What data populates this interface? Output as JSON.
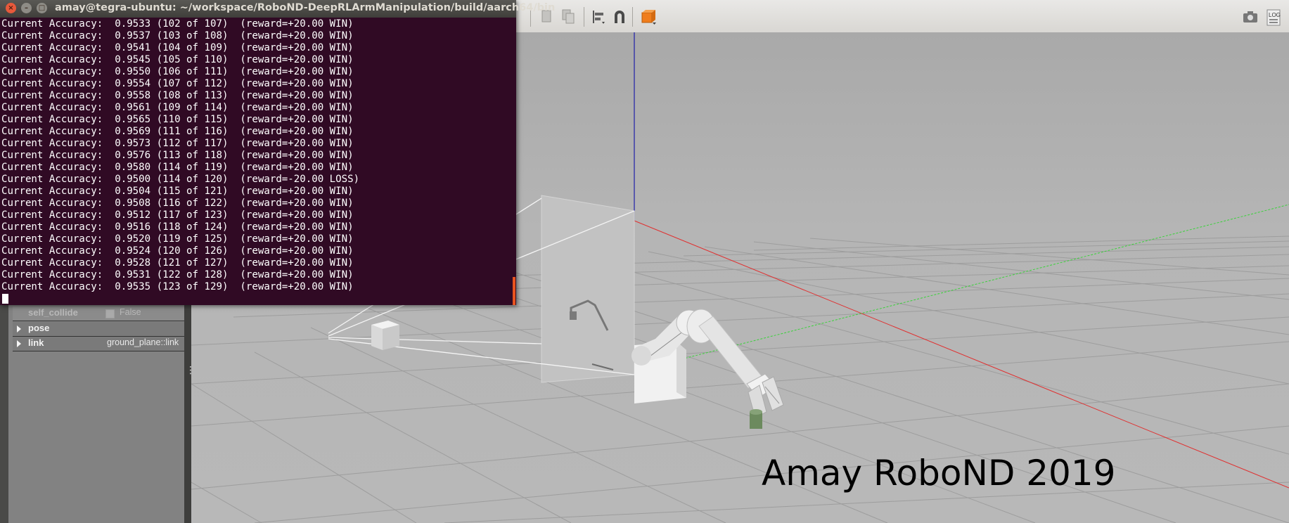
{
  "terminal": {
    "title": "amay@tegra-ubuntu: ~/workspace/RoboND-DeepRLArmManipulation/build/aarch64/bin",
    "lines": [
      "Current Accuracy:  0.9533 (102 of 107)  (reward=+20.00 WIN)",
      "Current Accuracy:  0.9537 (103 of 108)  (reward=+20.00 WIN)",
      "Current Accuracy:  0.9541 (104 of 109)  (reward=+20.00 WIN)",
      "Current Accuracy:  0.9545 (105 of 110)  (reward=+20.00 WIN)",
      "Current Accuracy:  0.9550 (106 of 111)  (reward=+20.00 WIN)",
      "Current Accuracy:  0.9554 (107 of 112)  (reward=+20.00 WIN)",
      "Current Accuracy:  0.9558 (108 of 113)  (reward=+20.00 WIN)",
      "Current Accuracy:  0.9561 (109 of 114)  (reward=+20.00 WIN)",
      "Current Accuracy:  0.9565 (110 of 115)  (reward=+20.00 WIN)",
      "Current Accuracy:  0.9569 (111 of 116)  (reward=+20.00 WIN)",
      "Current Accuracy:  0.9573 (112 of 117)  (reward=+20.00 WIN)",
      "Current Accuracy:  0.9576 (113 of 118)  (reward=+20.00 WIN)",
      "Current Accuracy:  0.9580 (114 of 119)  (reward=+20.00 WIN)",
      "Current Accuracy:  0.9500 (114 of 120)  (reward=-20.00 LOSS)",
      "Current Accuracy:  0.9504 (115 of 121)  (reward=+20.00 WIN)",
      "Current Accuracy:  0.9508 (116 of 122)  (reward=+20.00 WIN)",
      "Current Accuracy:  0.9512 (117 of 123)  (reward=+20.00 WIN)",
      "Current Accuracy:  0.9516 (118 of 124)  (reward=+20.00 WIN)",
      "Current Accuracy:  0.9520 (119 of 125)  (reward=+20.00 WIN)",
      "Current Accuracy:  0.9524 (120 of 126)  (reward=+20.00 WIN)",
      "Current Accuracy:  0.9528 (121 of 127)  (reward=+20.00 WIN)",
      "Current Accuracy:  0.9531 (122 of 128)  (reward=+20.00 WIN)",
      "Current Accuracy:  0.9535 (123 of 129)  (reward=+20.00 WIN)"
    ],
    "buttons": {
      "close": "×",
      "minimize": "–",
      "maximize": "□"
    },
    "colors": {
      "background": "#300a24",
      "text": "#ffffff",
      "accent": "#e95420"
    }
  },
  "gazebo": {
    "toolbar": {
      "icons": [
        "copy-icon",
        "paste-icon",
        "align-icon",
        "snap-icon",
        "view-angle-icon",
        "screenshot-icon",
        "log-icon"
      ],
      "log_label": "LOG"
    },
    "properties": [
      {
        "key": "self_collide",
        "value": "False",
        "type": "checkbox"
      },
      {
        "key": "pose",
        "value": "",
        "type": "expandable"
      },
      {
        "key": "link",
        "value": "ground_plane::link",
        "type": "expandable"
      }
    ],
    "watermark": "Amay RoboND 2019"
  }
}
